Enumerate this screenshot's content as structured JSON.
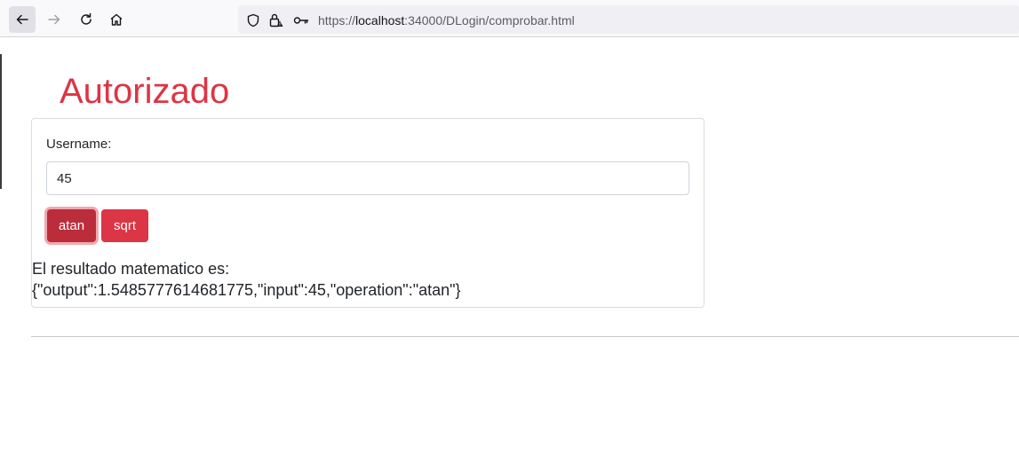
{
  "browser": {
    "url_prefix": "https://",
    "url_host": "localhost",
    "url_path": ":34000/DLogin/comprobar.html",
    "icons": [
      "back-arrow-icon",
      "forward-arrow-icon",
      "reload-icon",
      "home-icon",
      "shield-icon",
      "lock-warning-icon",
      "key-icon"
    ]
  },
  "page": {
    "title": "Autorizado",
    "title_color": "#dc3545"
  },
  "form": {
    "username_label": "Username:",
    "username_value": "45",
    "buttons": {
      "atan_label": "atan",
      "sqrt_label": "sqrt"
    },
    "button_color": "#dc3545"
  },
  "result": {
    "label": "El resultado matematico es:",
    "value": "{\"output\":1.5485777614681775,\"input\":45,\"operation\":\"atan\"}"
  }
}
